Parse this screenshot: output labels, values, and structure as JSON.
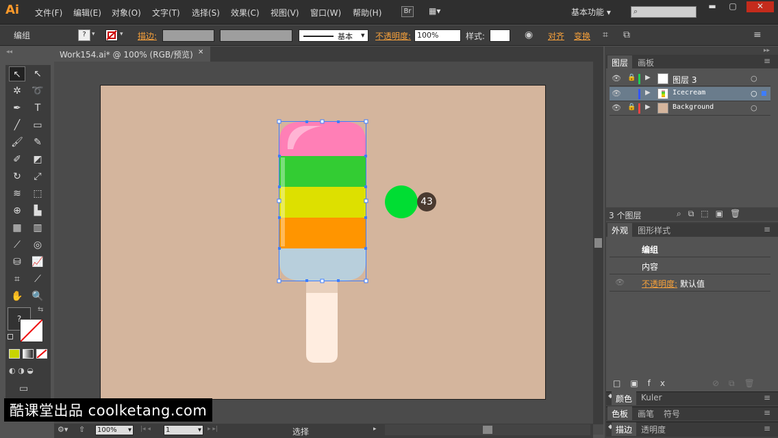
{
  "app": {
    "logo": "Ai"
  },
  "menu": [
    "文件(F)",
    "编辑(E)",
    "对象(O)",
    "文字(T)",
    "选择(S)",
    "效果(C)",
    "视图(V)",
    "窗口(W)",
    "帮助(H)"
  ],
  "bridge_btn": "Br",
  "workspace": "基本功能",
  "window_controls": {
    "min": "▬",
    "max": "▢",
    "close": "✕"
  },
  "control": {
    "selection_type": "编组",
    "fill_icon": "?",
    "stroke_label": "描边:",
    "stroke_style": "基本",
    "opacity_label": "不透明度:",
    "opacity_value": "100%",
    "style_label": "样式:",
    "align_label": "对齐",
    "transform_label": "变换"
  },
  "document": {
    "tab_title": "Work154.ai* @ 100% (RGB/预览)",
    "close": "✕"
  },
  "annotation": {
    "number": "43"
  },
  "status": {
    "zoom": "100%",
    "page": "1",
    "tool": "选择"
  },
  "toolbox": {
    "fill_stroke_icon": "?"
  },
  "layers_panel": {
    "tabs": [
      "图层",
      "画板"
    ],
    "layers": [
      {
        "name": "图层 3",
        "color": "#22cc55",
        "selected": false
      },
      {
        "name": "Icecream",
        "color": "#3355ff",
        "selected": true
      },
      {
        "name": "Background",
        "color": "#ee4444",
        "selected": false
      }
    ],
    "count": "3 个图层"
  },
  "appearance_panel": {
    "tabs": [
      "外观",
      "图形样式"
    ],
    "title": "编组",
    "content_label": "内容",
    "opacity_label": "不透明度:",
    "opacity_value": "默认值"
  },
  "collapsed_panels": [
    {
      "tabs": [
        "颜色",
        "Kuler"
      ]
    },
    {
      "tabs": [
        "色板",
        "画笔",
        "符号"
      ]
    },
    {
      "tabs": [
        "描边",
        "透明度"
      ]
    }
  ],
  "colors": {
    "pink": "#ff7fb6",
    "green": "#33cc33",
    "yellow": "#dde000",
    "orange": "#ff9500",
    "lightblue": "#b8cfdc",
    "stick": "#ffede0",
    "dot": "#00dd33",
    "artboard": "#d4b59d"
  },
  "watermark": "酷课堂出品 coolketang.com"
}
